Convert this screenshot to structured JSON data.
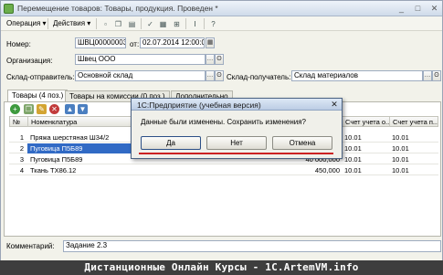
{
  "window": {
    "title": "Перемещение товаров: Товары, продукция. Проведен *",
    "controls": [
      "minimize-icon",
      "restore-icon",
      "close-icon"
    ]
  },
  "toolbar": {
    "operation_label": "Операция",
    "actions_label": "Действия",
    "icons": [
      "new-doc-icon",
      "copy-icon",
      "save-icon",
      "post-icon",
      "unpost-icon",
      "structure-icon",
      "movements-icon",
      "help-icon"
    ]
  },
  "header": {
    "number_label": "Номер:",
    "number_value": "ШВЦ00000003",
    "date_label": "от:",
    "date_value": "02.07.2014 12:00:02",
    "org_label": "Организация:",
    "org_value": "Швец ООО",
    "sender_label": "Склад-отправитель:",
    "sender_value": "Основной склад",
    "receiver_label": "Склад-получатель:",
    "receiver_value": "Склад материалов"
  },
  "tabs": [
    {
      "label": "Товары (4 поз.)",
      "active": true
    },
    {
      "label": "Товары на комиссии (0 поз.)",
      "active": false
    },
    {
      "label": "Дополнительно",
      "active": false
    }
  ],
  "table": {
    "toolbar_icons": [
      "add-row-icon",
      "copy-row-icon",
      "edit-row-icon",
      "delete-row-icon",
      "move-up-icon",
      "move-down-icon"
    ],
    "columns": [
      "№",
      "Номенклатура",
      "Счет учета о...",
      "Счет учета п..."
    ],
    "rows": [
      {
        "n": "1",
        "name": "Пряжа шерстяная Ш34/2",
        "amount": "",
        "acc1": "10.01",
        "acc2": "10.01",
        "selected": false
      },
      {
        "n": "2",
        "name": "Пуговица П5Б89",
        "amount": "",
        "acc1": "10.01",
        "acc2": "10.01",
        "selected": true
      },
      {
        "n": "3",
        "name": "Пуговица П5Б89",
        "amount": "40 000,000",
        "acc1": "10.01",
        "acc2": "10.01",
        "selected": false
      },
      {
        "n": "4",
        "name": "Ткань ТХ86.12",
        "amount": "450,000",
        "acc1": "10.01",
        "acc2": "10.01",
        "selected": false
      }
    ]
  },
  "dialog": {
    "title": "1С:Предприятие (учебная версия)",
    "message": "Данные были изменены. Сохранить изменения?",
    "buttons": [
      "Да",
      "Нет",
      "Отмена"
    ]
  },
  "comment": {
    "label": "Комментарий:",
    "value": "Задание 2.3"
  },
  "banner": {
    "text": "Дистанционные Онлайн Курсы - 1С.ArtemVM.info"
  }
}
